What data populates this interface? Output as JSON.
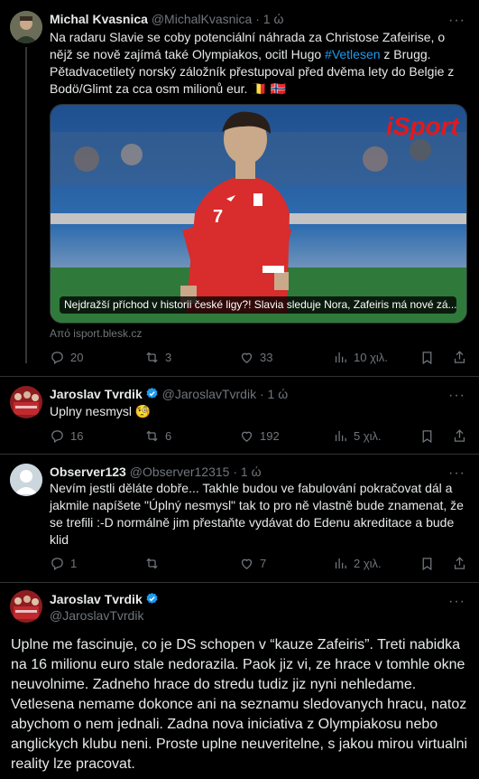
{
  "tweet1": {
    "name": "Michal Kvasnica",
    "handle": "@MichalKvasnica",
    "dot": "·",
    "time": "1 ώ",
    "text": "Na radaru Slavie se coby potenciální náhrada za Christose Zafeirise, o nějž se nově zajímá také Olympiakos, ocitl Hugo ",
    "hashtag": "#Vetlesen",
    "text_after": " z Brugg.",
    "text2": "Pětadvacetiletý norský záložník přestupoval před dvěma lety do Belgie z Bodö/Glimt za cca osm milionů eur.",
    "flags": "🇧🇪 🇳🇴",
    "card": {
      "caption": "Nejdražší příchod v historii české ligy?! Slavia sleduje Nora, Zafeiris má nové zá...",
      "logo": "iSport",
      "from": "Από isport.blesk.cz"
    },
    "stats": {
      "replies": "20",
      "reposts": "3",
      "likes": "33",
      "views": "10 χιλ."
    }
  },
  "tweet2": {
    "name": "Jaroslav Tvrdik",
    "handle": "@JaroslavTvrdik",
    "dot": "·",
    "time": "1 ώ",
    "text": "Uplny nesmysl 🧐",
    "stats": {
      "replies": "16",
      "reposts": "6",
      "likes": "192",
      "views": "5 χιλ."
    }
  },
  "tweet3": {
    "name": "Observer123",
    "handle": "@Observer12315",
    "dot": "·",
    "time": "1 ώ",
    "text": "Nevím jestli děláte dobře... Takhle budou ve fabulování pokračovat dál a jakmile napíšete \"Úplný nesmysl\" tak to pro ně vlastně bude znamenat, že se trefili :-D normálně jim přestaňte vydávat do Edenu akreditace a bude klid",
    "stats": {
      "replies": "1",
      "reposts": "",
      "likes": "7",
      "views": "2 χιλ."
    }
  },
  "tweet4": {
    "name": "Jaroslav Tvrdik",
    "handle": "@JaroslavTvrdik",
    "text": "Uplne me fascinuje, co je DS schopen v “kauze Zafeiris”. Treti nabidka na 16 milionu euro stale nedorazila. Paok jiz vi, ze hrace v tomhle okne neuvolnime. Zadneho hrace do stredu tudiz jiz nyni nehledame. Vetlesena nemame dokonce ani na seznamu sledovanych hracu, natoz abychom o nem jednali. Zadna nova iniciativa z Olympiakosu nebo anglickych klubu neni. Proste uplne neuveritelne, s jakou mirou virtualni reality lze pracovat."
  },
  "colors": {
    "accent": "#1d9bf0",
    "muted": "#71767b",
    "text": "#e7e9ea",
    "background": "#000000"
  }
}
